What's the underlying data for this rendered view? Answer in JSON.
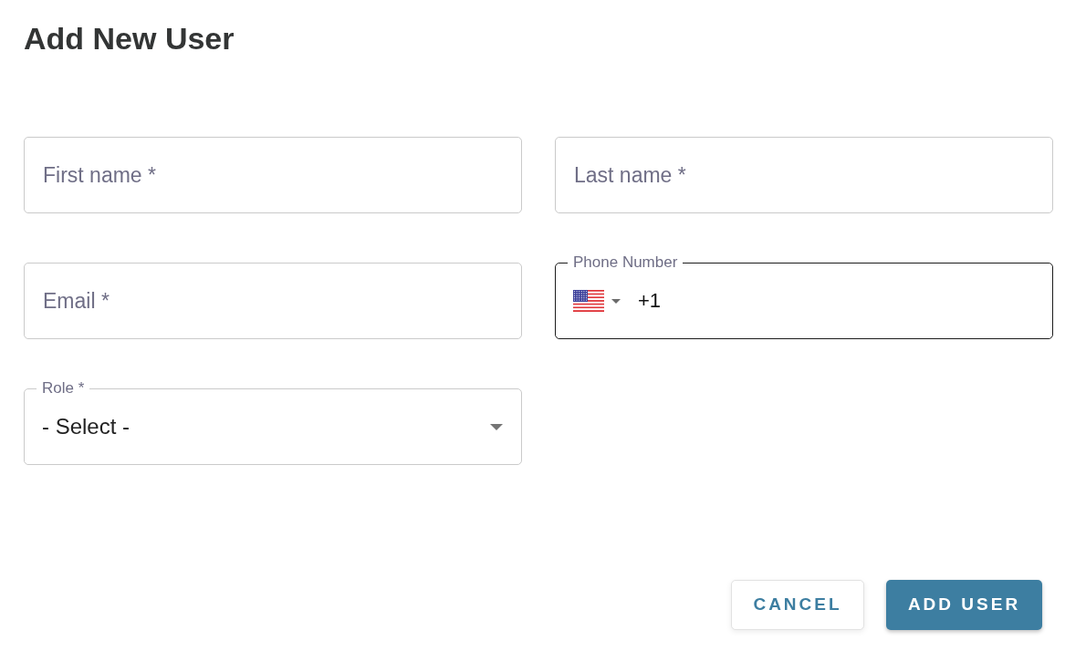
{
  "title": "Add New User",
  "rows": [
    {
      "fields": [
        {
          "kind": "text",
          "label": "First name *",
          "focused": false
        },
        {
          "kind": "text",
          "label": "Last name *",
          "focused": false
        }
      ]
    },
    {
      "fields": [
        {
          "kind": "text",
          "label": "Email *",
          "focused": false
        },
        {
          "kind": "phone",
          "label": "Phone Number",
          "value": "+1",
          "focused": true
        }
      ]
    },
    {
      "fields": [
        {
          "kind": "select",
          "label": "Role *",
          "value": "- Select -",
          "focused": false
        }
      ]
    }
  ],
  "buttons": [
    {
      "label": "CANCEL",
      "kind": "secondary"
    },
    {
      "label": "ADD USER",
      "kind": "primary"
    }
  ]
}
